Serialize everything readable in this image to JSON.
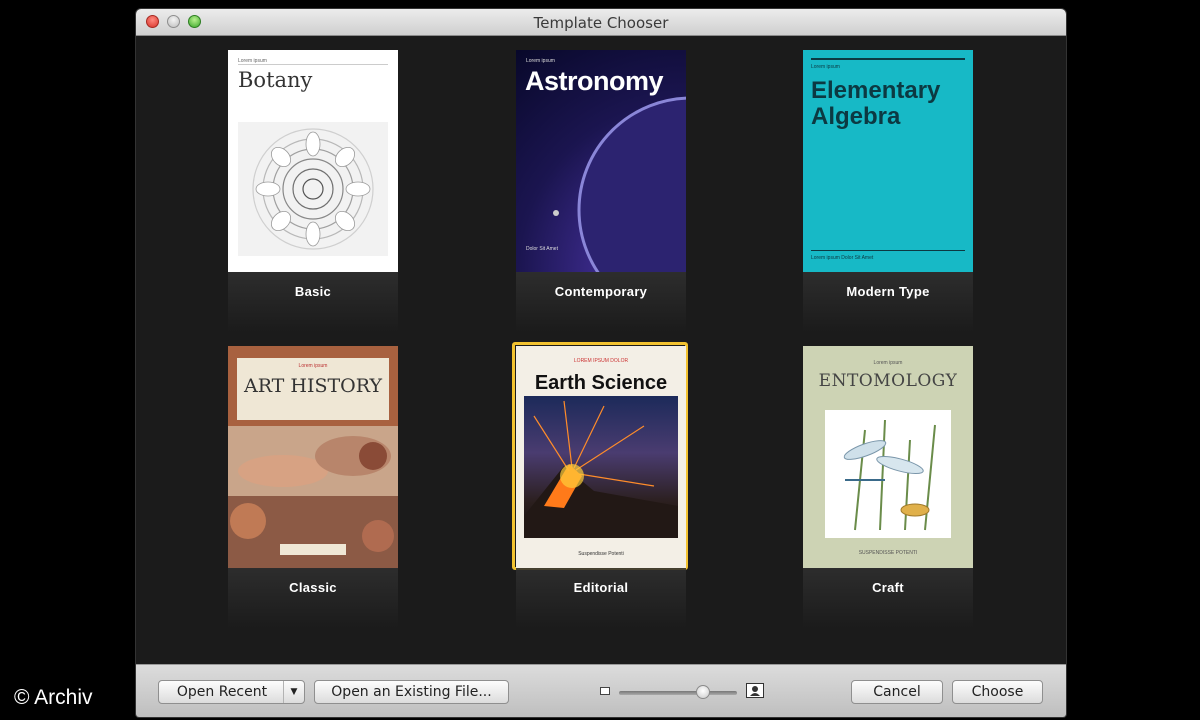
{
  "window": {
    "title": "Template Chooser"
  },
  "templates": [
    {
      "name": "Basic",
      "cover_title": "Botany",
      "selected": false
    },
    {
      "name": "Contemporary",
      "cover_title": "Astronomy",
      "selected": false
    },
    {
      "name": "Modern Type",
      "cover_title": "Elementary Algebra",
      "selected": false
    },
    {
      "name": "Classic",
      "cover_title": "ART HISTORY",
      "selected": false
    },
    {
      "name": "Editorial",
      "cover_title": "Earth Science",
      "selected": true
    },
    {
      "name": "Craft",
      "cover_title": "ENTOMOLOGY",
      "selected": false
    }
  ],
  "bottom_bar": {
    "open_recent": "Open Recent",
    "open_existing": "Open an Existing File...",
    "cancel": "Cancel",
    "choose": "Choose",
    "zoom_level": 0.7
  },
  "watermark": "© Archiv",
  "colors": {
    "selection": "#f2c230",
    "algebra_cover": "#17b9c6"
  }
}
